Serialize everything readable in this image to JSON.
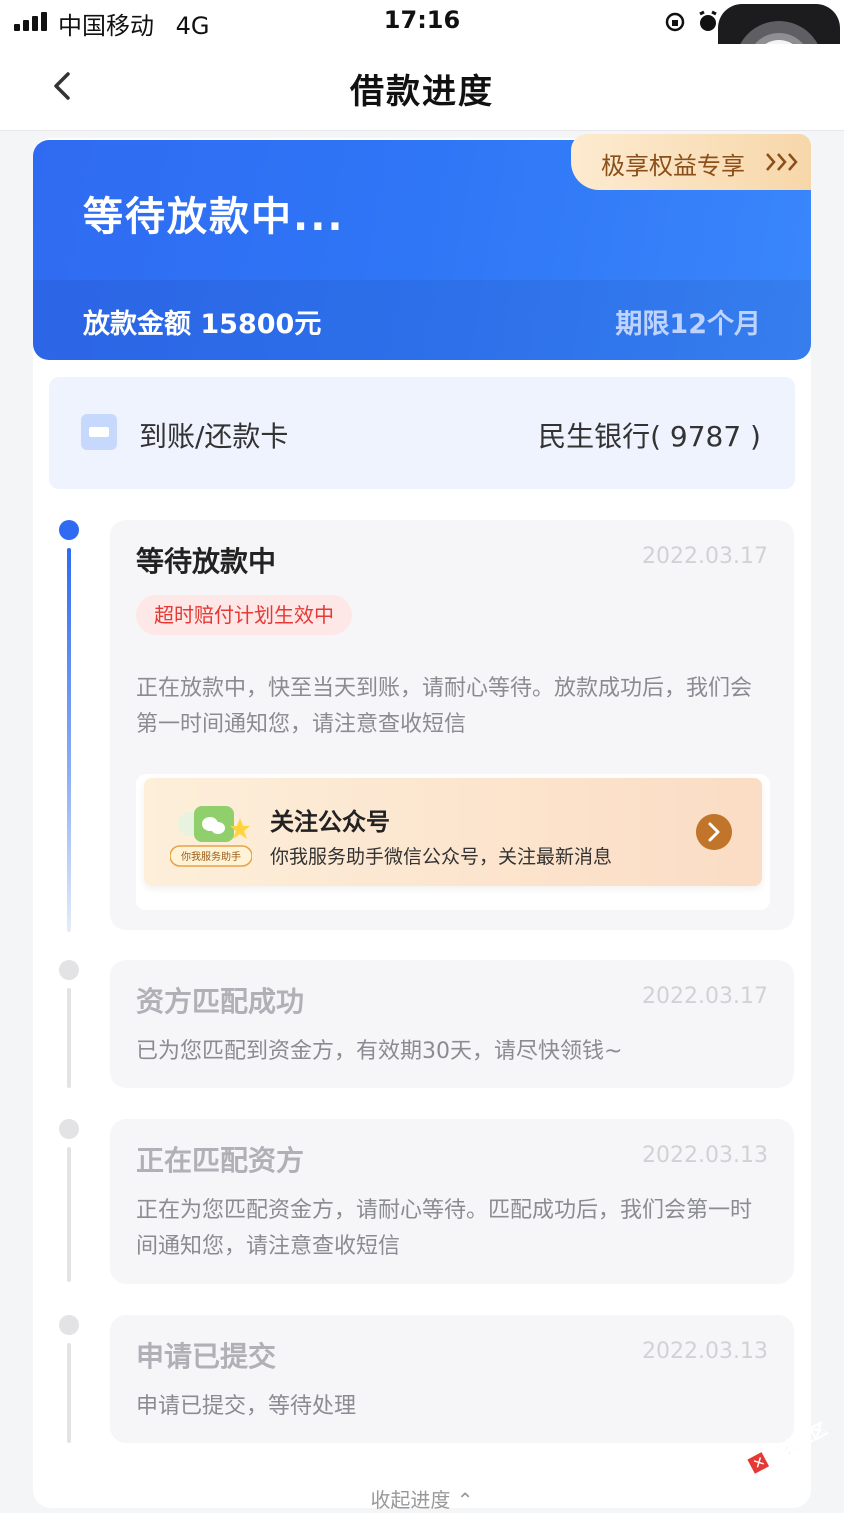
{
  "status_bar": {
    "carrier": "中国移动",
    "network": "4G",
    "time": "17:16"
  },
  "nav": {
    "title": "借款进度",
    "back_icon": "chevron-left-icon"
  },
  "banner": {
    "status": "等待放款中...",
    "amount_text": "放款金额 15800元",
    "term_text": "期限12个月",
    "perk_label": "极享权益专享"
  },
  "bank": {
    "label": "到账/还款卡",
    "value": "民生银行( 9787 )"
  },
  "steps": [
    {
      "title": "等待放款中",
      "date": "2022.03.17",
      "badge": "超时赔付计划生效中",
      "desc": "正在放款中，快至当天到账，请耐心等待。放款成功后，我们会第一时间通知您，请注意查收短信",
      "active": true
    },
    {
      "title": "资方匹配成功",
      "date": "2022.03.17",
      "desc": "已为您匹配到资金方，有效期30天，请尽快领钱~",
      "active": false
    },
    {
      "title": "正在匹配资方",
      "date": "2022.03.13",
      "desc": "正在为您匹配资金方，请耐心等待。匹配成功后，我们会第一时间通知您，请注意查收短信",
      "active": false
    },
    {
      "title": "申请已提交",
      "date": "2022.03.13",
      "desc": "申请已提交，等待处理",
      "active": false
    }
  ],
  "follow": {
    "title": "关注公众号",
    "subtitle": "你我服务助手微信公众号，关注最新消息",
    "icon_tag": "你我服务助手"
  },
  "collapse_label": "收起进度",
  "watermark": "卡农社区",
  "colors": {
    "accent": "#2f6bf2",
    "badge_red": "#e53935",
    "perk_brown": "#8a4f1a"
  }
}
